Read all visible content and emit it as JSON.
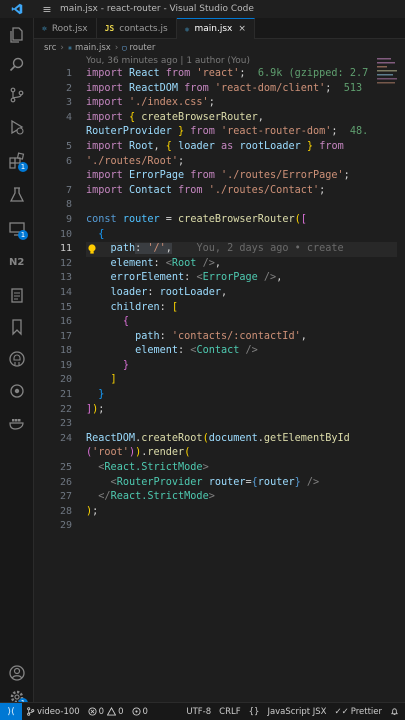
{
  "window": {
    "title": "main.jsx - react-router - Visual Studio Code",
    "menu_glyph": "≡"
  },
  "tabs": [
    {
      "icon": "⚛",
      "label": "Root.jsx",
      "active": false
    },
    {
      "icon": "JS",
      "label": "contacts.js",
      "active": false
    },
    {
      "icon": "⚛",
      "label": "main.jsx",
      "active": true,
      "close": "×"
    }
  ],
  "breadcrumb": {
    "folder": "src",
    "file": "main.jsx",
    "symbol": "router",
    "sep": "›"
  },
  "blame": {
    "top": "You, 36 minutes ago | 1 author (You)",
    "inline": "You, 2 days ago • create"
  },
  "editor": {
    "line_numbers": [
      "1",
      "2",
      "3",
      "4",
      "",
      "5",
      "6",
      "",
      "7",
      "8",
      "9",
      "10",
      "11",
      "12",
      "13",
      "14",
      "15",
      "16",
      "17",
      "18",
      "19",
      "20",
      "21",
      "22",
      "23",
      "24",
      "",
      "25",
      "26",
      "27",
      "28",
      "29"
    ],
    "current_line": "11"
  },
  "code_text": {
    "l1a": "import",
    "l1b": "React",
    "l1c": "from",
    "l1d": "'react'",
    "l1e": ";",
    "l1hint": "6.9k (gzipped: 2.7",
    "l2a": "import",
    "l2b": "ReactDOM",
    "l2c": "from",
    "l2d": "'react-dom/client'",
    "l2e": ";",
    "l2hint": "513",
    "l3a": "import",
    "l3b": "'./index.css'",
    "l3c": ";",
    "l4a": "import",
    "l4b": "{",
    "l4c": "createBrowserRouter",
    "l4d": ",",
    "l4e": "RouterProvider",
    "l4f": "}",
    "l4g": "from",
    "l4h": "'react-router-dom'",
    "l4i": ";",
    "l4hint": "48.",
    "l5a": "import",
    "l5b": "Root",
    "l5c": ",",
    "l5d": "{",
    "l5e": "loader",
    "l5f": "as",
    "l5g": "rootLoader",
    "l5h": "}",
    "l5i": "from",
    "l5j": "'./routes/Root'",
    "l5k": ";",
    "l6a": "import",
    "l6b": "ErrorPage",
    "l6c": "from",
    "l6d": "'./routes/ErrorPage'",
    "l6e": ";",
    "l7a": "import",
    "l7b": "Contact",
    "l7c": "from",
    "l7d": "'./routes/Contact'",
    "l7e": ";",
    "l9a": "const",
    "l9b": "router",
    "l9c": "=",
    "l9d": "createBrowserRouter",
    "l9e": "(",
    "l9f": "[",
    "l10": "{",
    "l11a": "path",
    "l11b": ":",
    "l11c": "'/'",
    "l11d": ",",
    "l12a": "element",
    "l12b": ":",
    "l12c": "<",
    "l12d": "Root",
    "l12e": "/>",
    "l12f": ",",
    "l13a": "errorElement",
    "l13b": ":",
    "l13c": "<",
    "l13d": "ErrorPage",
    "l13e": "/>",
    "l13f": ",",
    "l14a": "loader",
    "l14b": ":",
    "l14c": "rootLoader",
    "l14d": ",",
    "l15a": "children",
    "l15b": ":",
    "l15c": "[",
    "l16": "{",
    "l17a": "path",
    "l17b": ":",
    "l17c": "'contacts/:contactId'",
    "l17d": ",",
    "l18a": "element",
    "l18b": ":",
    "l18c": "<",
    "l18d": "Contact",
    "l18e": "/>",
    "l19": "}",
    "l20": "]",
    "l21": "}",
    "l22a": "]",
    "l22b": ")",
    "l22c": ";",
    "l24a": "ReactDOM",
    "l24b": ".",
    "l24c": "createRoot",
    "l24d": "(",
    "l24e": "document",
    "l24f": ".",
    "l24g": "getElementById",
    "l24h": "(",
    "l24i": "'root'",
    "l24j": ")",
    "l24k": ")",
    "l24l": ".",
    "l24m": "render",
    "l24n": "(",
    "l25a": "<",
    "l25b": "React.StrictMode",
    "l25c": ">",
    "l26a": "<",
    "l26b": "RouterProvider",
    "l26c": "router",
    "l26d": "=",
    "l26e": "{",
    "l26f": "router",
    "l26g": "}",
    "l26h": "/>",
    "l27a": "</",
    "l27b": "React.StrictMode",
    "l27c": ">",
    "l28a": ")",
    "l28b": ";"
  },
  "status": {
    "branch": "video-100",
    "errors": "0",
    "warnings": "0",
    "ports": "0",
    "encoding": "UTF-8",
    "eol": "CRLF",
    "brackets": "{}",
    "language": "JavaScript JSX",
    "prettier": "Prettier"
  },
  "colors": {
    "accent": "#0078d4",
    "keyword": "#c586c0",
    "string": "#ce9178",
    "variable": "#9cdcfe"
  }
}
